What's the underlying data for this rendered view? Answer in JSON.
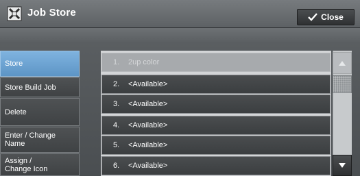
{
  "window": {
    "title": "Job Store",
    "title_icon": "job-store-icon",
    "close_label": "Close",
    "close_icon": "check-icon"
  },
  "nav": {
    "items": [
      {
        "label": "Store",
        "active": true
      },
      {
        "label": "Store Build Job",
        "active": false
      },
      {
        "label": "Delete",
        "active": false
      },
      {
        "label": "Enter / Change\nName",
        "active": false
      },
      {
        "label": "Assign /\nChange Icon",
        "active": false
      }
    ]
  },
  "jobs": [
    {
      "number": "1.",
      "name": "2up color",
      "enabled": false
    },
    {
      "number": "2.",
      "name": "<Available>",
      "enabled": true
    },
    {
      "number": "3.",
      "name": "<Available>",
      "enabled": true
    },
    {
      "number": "4.",
      "name": "<Available>",
      "enabled": true
    },
    {
      "number": "5.",
      "name": "<Available>",
      "enabled": true
    },
    {
      "number": "6.",
      "name": "<Available>",
      "enabled": true
    }
  ],
  "scrollbar": {
    "up_icon": "triangle-up-icon",
    "down_icon": "triangle-down-icon",
    "up_enabled": false,
    "down_enabled": true
  },
  "colors": {
    "active_nav": "#6fa6d6",
    "row_bg": "#434648",
    "disabled_row_bg": "#a7aaad"
  }
}
